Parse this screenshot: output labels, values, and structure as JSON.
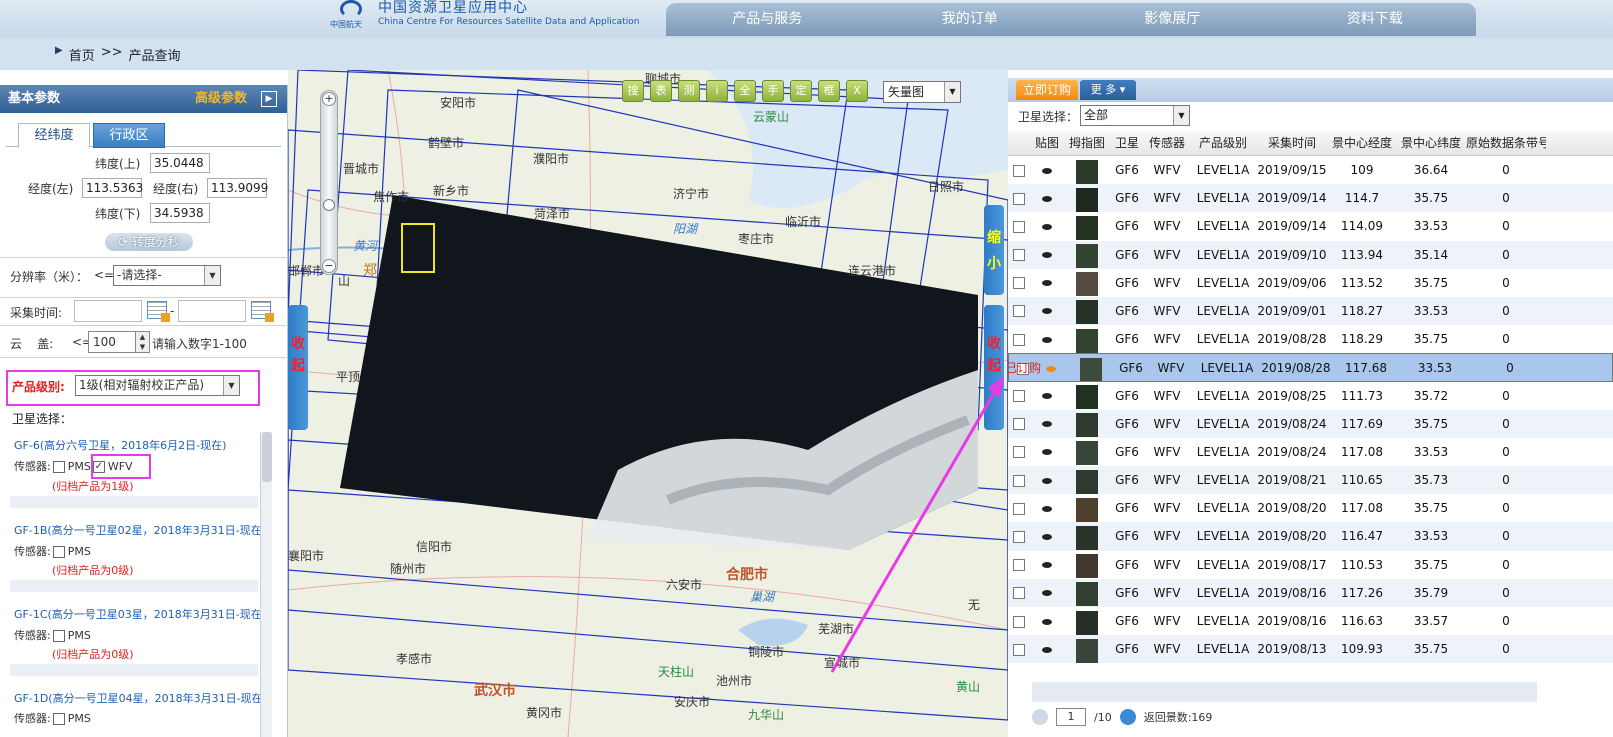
{
  "header": {
    "logo_cn": "中国资源卫星应用中心",
    "logo_en": "China Centre For Resources Satellite Data and Application",
    "logo_mark": "中国航天",
    "nav": [
      "产品与服务",
      "我的订单",
      "影像展厅",
      "资料下载"
    ]
  },
  "breadcrumb": {
    "home": "首页",
    "sep": ">>",
    "current": "产品查询"
  },
  "left": {
    "title": "基本参数",
    "advanced": "高级参数",
    "tabs": [
      "经纬度",
      "行政区"
    ],
    "lat_top_label": "纬度(上)",
    "lat_top": "35.0448",
    "lon_left_label": "经度(左)",
    "lon_left": "113.5363",
    "lon_right_label": "经度(右)",
    "lon_right": "113.9099",
    "lat_bottom_label": "纬度(下)",
    "lat_bottom": "34.5938",
    "convert_btn": "转度分秒",
    "resolution_label": "分辨率（米）：",
    "resolution_op": "<=",
    "resolution_value": "-请选择-",
    "time_label": "采集时间:",
    "time_sep": "-",
    "cloud_label": "云    盖:",
    "cloud_op": "<=",
    "cloud_value": "100",
    "cloud_hint": "请输入数字1-100",
    "product_level_label": "产品级别:",
    "product_level_value": "1级(相对辐射校正产品)",
    "sat_select_label": "卫星选择：",
    "satellites": [
      {
        "title": "GF-6(高分六号卫星，2018年6月2日-现在)",
        "sensors": "传感器:",
        "s1": "PMS",
        "s2": "WFV",
        "s2_checked": "✓",
        "note": "(归档产品为1级)"
      },
      {
        "title": "GF-1B(高分一号卫星02星，2018年3月31日-现在",
        "sensors": "传感器:",
        "s1": "PMS",
        "note": "(归档产品为0级)"
      },
      {
        "title": "GF-1C(高分一号卫星03星，2018年3月31日-现在",
        "sensors": "传感器:",
        "s1": "PMS",
        "note": "(归档产品为0级)"
      },
      {
        "title": "GF-1D(高分一号卫星04星，2018年3月31日-现在",
        "sensors": "传感器:",
        "s1": "PMS"
      }
    ]
  },
  "map": {
    "layer": "矢量图",
    "collapse_left": "收起",
    "collapse_right": "收起",
    "shrink": "缩小",
    "zoom_in": "+",
    "zoom_out": "−",
    "labels": [
      "安阳市",
      "鹤壁市",
      "濮阳市",
      "晋城市",
      "焦作市",
      "新乡市",
      "菏泽市",
      "济宁市",
      "临沂市",
      "日照市",
      "枣庄市",
      "连云港市",
      "聊城市",
      "云蒙山",
      "阳湖",
      "黄河",
      "郑",
      "山",
      "平顶",
      "信阳市",
      "随州市",
      "六安市",
      "合肥市",
      "巢湖",
      "芜湖市",
      "孝感市",
      "铜陵市",
      "宣城市",
      "天柱山",
      "武汉市",
      "安庆市",
      "池州市",
      "黄冈市",
      "九华山",
      "黄山",
      "襄阳市",
      "邯郸市",
      "无"
    ],
    "tools": [
      "搜",
      "表",
      "测",
      "i",
      "全",
      "手",
      "定",
      "框",
      "X"
    ]
  },
  "right": {
    "order_btn": "立即订购",
    "more_btn": "更 多",
    "sat_filter_label": "卫星选择：",
    "sat_filter_value": "全部",
    "columns": [
      "贴图",
      "拇指图",
      "卫星",
      "传感器",
      "产品级别",
      "采集时间",
      "景中心经度",
      "景中心纬度",
      "原始数据条带号"
    ],
    "ordered_mark": "已订购",
    "rows": [
      [
        "GF6",
        "WFV",
        "LEVEL1A",
        "2019/09/15",
        "109",
        "36.64",
        "0"
      ],
      [
        "GF6",
        "WFV",
        "LEVEL1A",
        "2019/09/14",
        "114.7",
        "35.75",
        "0"
      ],
      [
        "GF6",
        "WFV",
        "LEVEL1A",
        "2019/09/14",
        "114.09",
        "33.53",
        "0"
      ],
      [
        "GF6",
        "WFV",
        "LEVEL1A",
        "2019/09/10",
        "113.94",
        "35.14",
        "0"
      ],
      [
        "GF6",
        "WFV",
        "LEVEL1A",
        "2019/09/06",
        "113.52",
        "35.75",
        "0"
      ],
      [
        "GF6",
        "WFV",
        "LEVEL1A",
        "2019/09/01",
        "118.27",
        "33.53",
        "0"
      ],
      [
        "GF6",
        "WFV",
        "LEVEL1A",
        "2019/08/28",
        "118.29",
        "35.75",
        "0"
      ],
      [
        "GF6",
        "WFV",
        "LEVEL1A",
        "2019/08/28",
        "117.68",
        "33.53",
        "0"
      ],
      [
        "GF6",
        "WFV",
        "LEVEL1A",
        "2019/08/25",
        "111.73",
        "35.72",
        "0"
      ],
      [
        "GF6",
        "WFV",
        "LEVEL1A",
        "2019/08/24",
        "117.69",
        "35.75",
        "0"
      ],
      [
        "GF6",
        "WFV",
        "LEVEL1A",
        "2019/08/24",
        "117.08",
        "33.53",
        "0"
      ],
      [
        "GF6",
        "WFV",
        "LEVEL1A",
        "2019/08/21",
        "110.65",
        "35.73",
        "0"
      ],
      [
        "GF6",
        "WFV",
        "LEVEL1A",
        "2019/08/20",
        "117.08",
        "35.75",
        "0"
      ],
      [
        "GF6",
        "WFV",
        "LEVEL1A",
        "2019/08/20",
        "116.47",
        "33.53",
        "0"
      ],
      [
        "GF6",
        "WFV",
        "LEVEL1A",
        "2019/08/17",
        "110.53",
        "35.75",
        "0"
      ],
      [
        "GF6",
        "WFV",
        "LEVEL1A",
        "2019/08/16",
        "117.26",
        "35.79",
        "0"
      ],
      [
        "GF6",
        "WFV",
        "LEVEL1A",
        "2019/08/16",
        "116.63",
        "33.57",
        "0"
      ],
      [
        "GF6",
        "WFV",
        "LEVEL1A",
        "2019/08/13",
        "109.93",
        "35.75",
        "0"
      ]
    ],
    "pager": {
      "page": "1",
      "total": "/10",
      "info": "返回景数:169"
    }
  },
  "colors": {
    "accent": "#2f5f96",
    "highlight": "#e63be6",
    "selected_row": "#a9c7ec",
    "order": "#f08a10"
  }
}
